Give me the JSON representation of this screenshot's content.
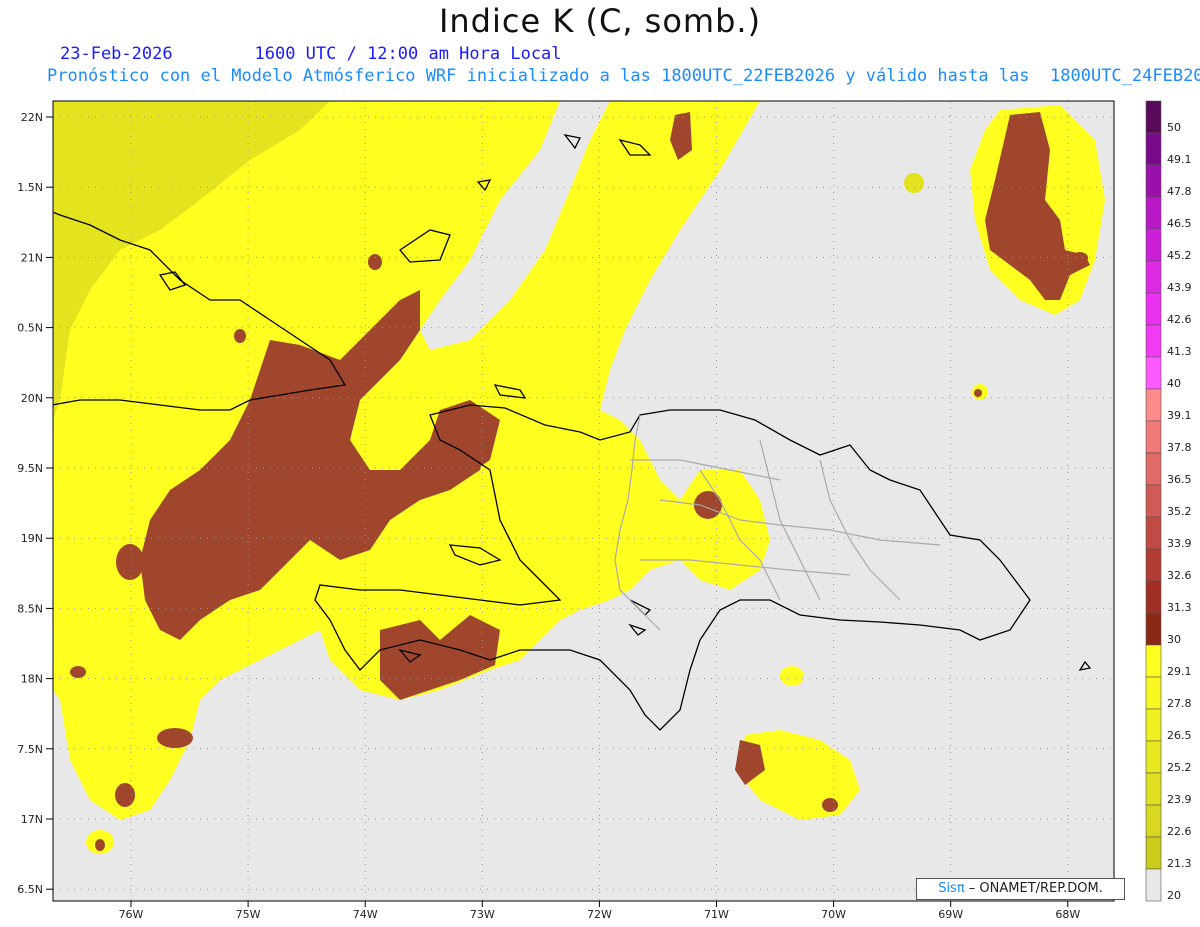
{
  "header": {
    "title": "Indice K (C, somb.)",
    "date": "23-Feb-2026",
    "time": "1600 UTC / 12:00 am Hora Local",
    "description": "Pronóstico con el Modelo Atmósferico WRF inicializado a las 1800UTC_22FEB2026 y válido hasta las  1800UTC_24FEB2026"
  },
  "axes": {
    "lat_labels": [
      "22N",
      "1.5N",
      "21N",
      "0.5N",
      "20N",
      "9.5N",
      "19N",
      "8.5N",
      "18N",
      "7.5N",
      "17N",
      "6.5N"
    ],
    "lon_labels": [
      "76W",
      "75W",
      "74W",
      "73W",
      "72W",
      "71W",
      "70W",
      "69W",
      "68W"
    ]
  },
  "legend": {
    "labels": [
      "50",
      "49.1",
      "47.8",
      "46.5",
      "45.2",
      "43.9",
      "42.6",
      "41.3",
      "40",
      "39.1",
      "37.8",
      "36.5",
      "35.2",
      "33.9",
      "32.6",
      "31.3",
      "30",
      "29.1",
      "27.8",
      "26.5",
      "25.2",
      "23.9",
      "22.6",
      "21.3",
      "20"
    ],
    "colors": [
      "#5a0a5a",
      "#7a0a8a",
      "#9a10aa",
      "#b818c8",
      "#cc20d8",
      "#dd28e4",
      "#ea30f0",
      "#f23af5",
      "#ff5aff",
      "#ff8a8a",
      "#ef7a78",
      "#e06a66",
      "#d05a55",
      "#c04a44",
      "#b03c34",
      "#a02e24",
      "#8b2a14",
      "#ffff20",
      "#f8f820",
      "#f0f020",
      "#e8e820",
      "#e0e020",
      "#d8d81e",
      "#cccc1c",
      "#e8e8e8"
    ]
  },
  "credit": {
    "brand": "Sisπ",
    "text": " – ONAMET/REP.DOM."
  },
  "colors": {
    "background": "#e8e8e8",
    "low": "#ffff20",
    "mid": "#e4e41e",
    "high": "#a0462c",
    "coast": "#000000",
    "border": "#aaaaaa"
  }
}
